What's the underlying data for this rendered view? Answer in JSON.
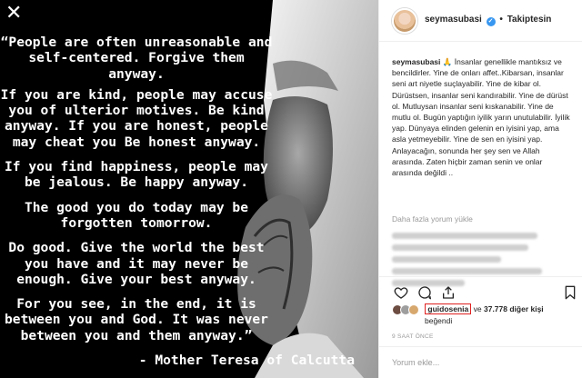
{
  "image": {
    "close_glyph": "✕",
    "quote_paragraphs": [
      "“People are often unreasonable and self-centered. Forgive them anyway.",
      "If you are kind, people may accuse you of ulterior motives. Be kind anyway. If you are honest, people may cheat you Be honest anyway.",
      "If you find happiness, people may be jealous. Be happy anyway.",
      "The good you do today may be forgotten tomorrow.",
      "Do good. Give the world the best you have and it may never be enough. Give your best anyway.",
      "For you see, in the end, it is between you and God. It was never between you and them anyway.”"
    ],
    "attribution": "- Mother Teresa of Calcutta"
  },
  "header": {
    "username": "seymasubasi",
    "verified_glyph": "✓",
    "separator": "•",
    "follow_status": "Takiptesin"
  },
  "caption": {
    "username": "seymasubasi",
    "emoji": "🙏",
    "text": "İnsanlar genellikle mantıksız ve bencildirler. Yine de onları affet..Kibarsan, insanlar seni art niyetle suçlayabilir. Yine de kibar ol. Dürüstsen, insanlar seni kandırabilir. Yine de dürüst ol. Mutluysan insanlar seni kıskanabilir. Yine de mutlu ol. Bugün yaptığın iyilik yarın unutulabilir. İyilik yap. Dünyaya elinden gelenin en iyisini yap, ama asla yetmeyebilir. Yine de sen en iyisini yap. Anlayacağın, sonunda her şey sen ve Allah arasında. Zaten hiçbir zaman senin ve onlar arasında değildi .."
  },
  "comments": {
    "load_more": "Daha fazla yorum yükle"
  },
  "likes": {
    "highlighted_user": "guidosenia",
    "connector": "ve",
    "count_text": "37.778 diğer kişi",
    "suffix": "beğendi"
  },
  "timestamp": "9 SAAT ÖNCE",
  "comment_input": {
    "placeholder": "Yorum ekle..."
  },
  "colors": {
    "verified": "#3897f0",
    "highlight_box": "#e02020",
    "secondary_text": "#999999"
  }
}
